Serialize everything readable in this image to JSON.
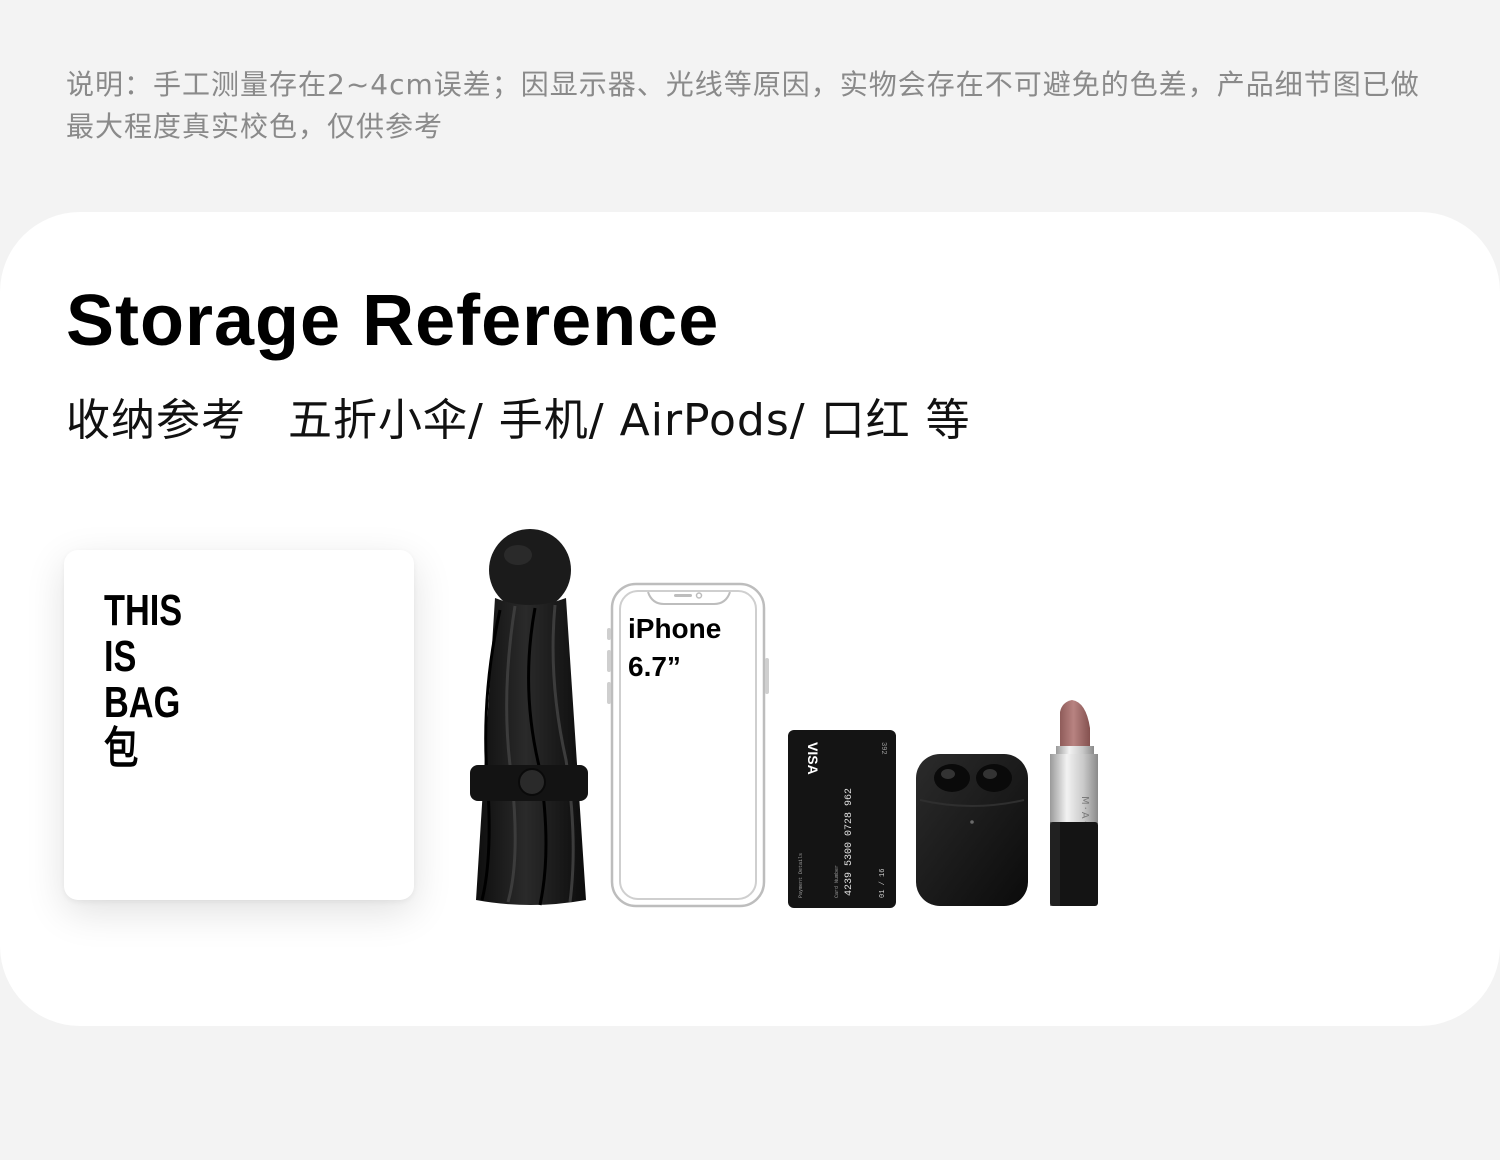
{
  "note": {
    "text": "说明：手工测量存在2~4cm误差；因显示器、光线等原因，实物会存在不可避免的色差，产品细节图已做最大程度真实校色，仅供参考"
  },
  "header": {
    "title": "Storage Reference",
    "subtitle_cn": "收纳参考",
    "subtitle_items": "五折小伞/ 手机/ AirPods/ 口红 等"
  },
  "bag": {
    "lines": [
      "THIS",
      "IS",
      "BAG",
      "包"
    ]
  },
  "phone": {
    "label_line1": "iPhone",
    "label_line2": "6.7”"
  },
  "card": {
    "brand": "VISA",
    "number": "4239 5300 0728 962",
    "small_label_1": "Payment Details",
    "small_label_2": "Card Number",
    "expiry": "01 / 16",
    "cvc": "392"
  },
  "lipstick": {
    "brand": "M·A·C"
  },
  "colors": {
    "background": "#f3f3f3",
    "card": "#ffffff",
    "note_text": "#8a8a8a",
    "product_black": "#1a1a1a",
    "lipstick": "#a9706d"
  }
}
